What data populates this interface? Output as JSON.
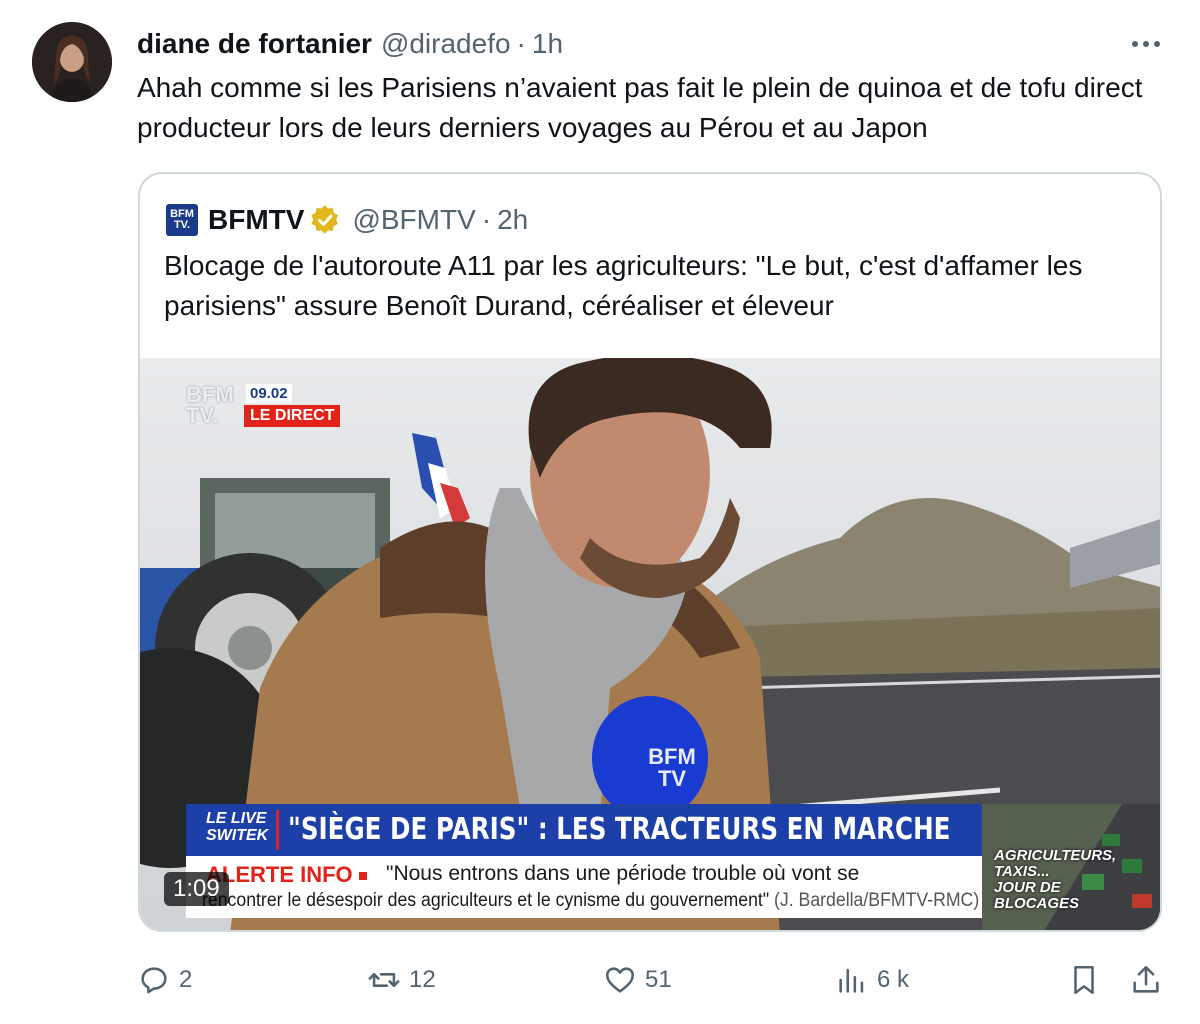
{
  "tweet": {
    "author_name": "diane de fortanier",
    "author_handle": "@diradefo",
    "separator": "·",
    "time": "1h",
    "text": "Ahah comme si les Parisiens n’avaient pas fait le plein de quinoa et de tofu direct producteur lors de leurs derniers voyages au Pérou et au Japon"
  },
  "quote": {
    "logo_text_top": "BFM",
    "logo_text_bottom": "TV.",
    "name": "BFMTV",
    "handle": "@BFMTV",
    "separator": "·",
    "time": "2h",
    "text": "Blocage de l'autoroute A11 par les agriculteurs: \"Le but, c'est d'affamer les parisiens\" assure Benoît Durand, céréaliser et éleveur"
  },
  "video": {
    "bug_top": "BFM",
    "bug_bottom": "TV.",
    "clock": "09.02",
    "live_badge": "LE DIRECT",
    "live_tag_line1": "LE LIVE",
    "live_tag_line2": "SWITEK",
    "headline": "\"SIÈGE DE PARIS\" : LES TRACTEURS EN MARCHE",
    "alert_label": "ALERTE INFO",
    "quote_line1": "\"Nous entrons dans une période trouble où vont se",
    "quote_line2": "rencontrer le désespoir des agriculteurs et le cynisme du gouvernement\"",
    "quote_credit": "(J. Bardella/BFMTV-RMC)",
    "thumb_line1": "AGRICULTEURS,",
    "thumb_line2": "TAXIS...",
    "thumb_line3": "JOUR DE",
    "thumb_line4": "BLOCAGES",
    "duration": "1:09",
    "mic_text": "BFM TV"
  },
  "actions": {
    "replies": "2",
    "reposts": "12",
    "likes": "51",
    "views": "6 k"
  },
  "colors": {
    "text": "#0f1419",
    "secondary": "#536471",
    "border": "#cfd9de",
    "bfm_blue": "#1c3fa8",
    "bfm_red": "#e2231a",
    "verified_gold": "#e2b719"
  }
}
